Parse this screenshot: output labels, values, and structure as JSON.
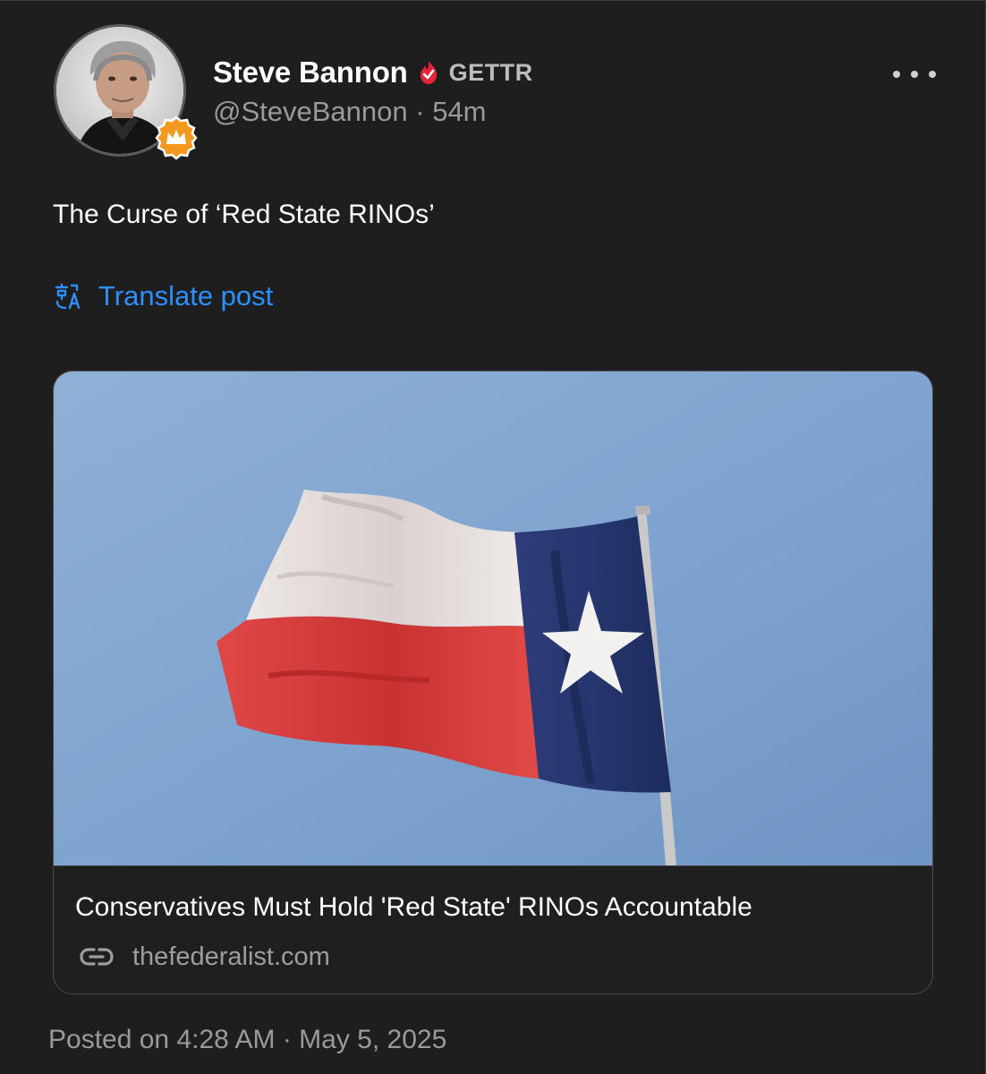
{
  "author": {
    "name": "Steve Bannon",
    "handle": "@SteveBannon",
    "separator": "·",
    "time_ago": "54m",
    "brand": "GETTR",
    "verified_icon": "flame-verified-icon",
    "badge_icon": "crown-badge-icon"
  },
  "post": {
    "text": "The Curse of ‘Red State RINOs’",
    "translate_label": "Translate post",
    "translate_icon": "translate-icon"
  },
  "link_card": {
    "image_icon": "texas-flag-image",
    "title": "Conservatives Must Hold 'Red State' RINOs Accountable",
    "domain": "thefederalist.com",
    "link_icon": "link-icon"
  },
  "footer": {
    "posted_text": "Posted on 4:28 AM · May 5, 2025"
  },
  "colors": {
    "background": "#1e1e1e",
    "accent_blue": "#2e8fff",
    "verified_red": "#e5253a",
    "badge_orange": "#f39a1e",
    "muted_text": "#9a9a9a"
  }
}
